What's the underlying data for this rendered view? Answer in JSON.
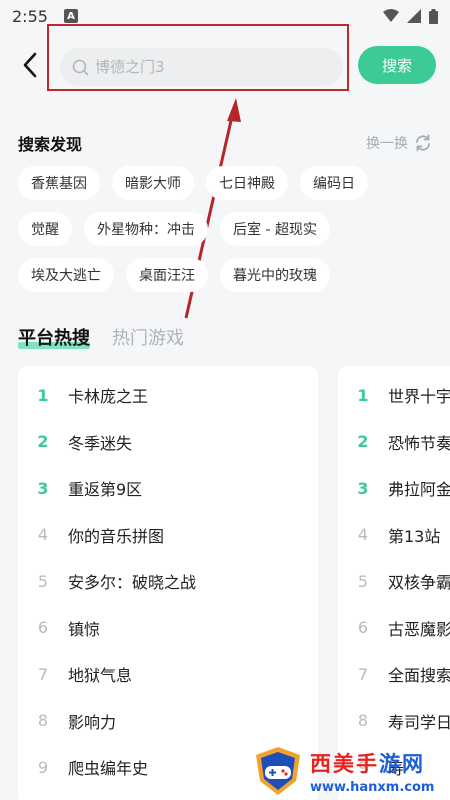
{
  "status_bar": {
    "time": "2:55",
    "notification_letter": "A"
  },
  "header": {
    "search_placeholder": "博德之门3",
    "search_button": "搜索"
  },
  "discover": {
    "title": "搜索发现",
    "refresh_label": "换一换",
    "tags": [
      [
        "香蕉基因",
        "暗影大师",
        "七日神殿",
        "编码日"
      ],
      [
        "觉醒",
        "外星物种：冲击",
        "后室 - 超现实"
      ],
      [
        "埃及大逃亡",
        "桌面汪汪",
        "暮光中的玫瑰"
      ]
    ]
  },
  "tabs": {
    "platform": "平台热搜",
    "games": "热门游戏"
  },
  "left_list": [
    {
      "rank": "1",
      "name": "卡林庞之王"
    },
    {
      "rank": "2",
      "name": "冬季迷失"
    },
    {
      "rank": "3",
      "name": "重返第9区"
    },
    {
      "rank": "4",
      "name": "你的音乐拼图"
    },
    {
      "rank": "5",
      "name": "安多尔：破晓之战"
    },
    {
      "rank": "6",
      "name": "镇惊"
    },
    {
      "rank": "7",
      "name": "地狱气息"
    },
    {
      "rank": "8",
      "name": "影响力"
    },
    {
      "rank": "9",
      "name": "爬虫编年史"
    }
  ],
  "right_list": [
    {
      "rank": "1",
      "name": "世界十宇"
    },
    {
      "rank": "2",
      "name": "恐怖节奏"
    },
    {
      "rank": "3",
      "name": "弗拉阿金"
    },
    {
      "rank": "4",
      "name": "第13站"
    },
    {
      "rank": "5",
      "name": "双核争霸"
    },
    {
      "rank": "6",
      "name": "古恶魔影"
    },
    {
      "rank": "7",
      "name": "全面搜索"
    },
    {
      "rank": "8",
      "name": "寿司学日"
    },
    {
      "rank": "9",
      "name": "寿"
    }
  ],
  "watermark": {
    "title_red": "西美手",
    "title_blue": "游网",
    "url": "www.hanxm.com"
  },
  "colors": {
    "accent": "#3ccb95",
    "highlight_box": "#c0272d",
    "tab_underline": "#7fe3bd"
  }
}
